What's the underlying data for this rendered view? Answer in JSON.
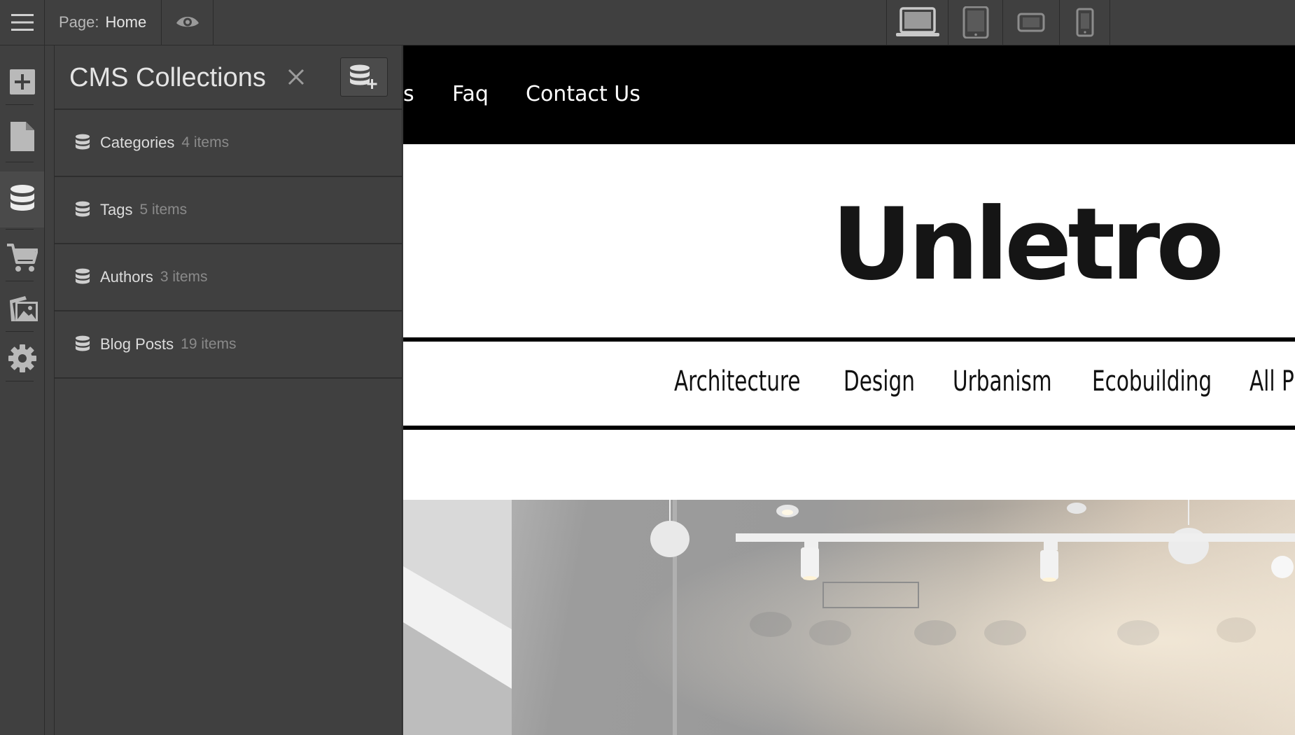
{
  "topbar": {
    "page_label": "Page:",
    "page_value": "Home",
    "icons": [
      "menu-icon",
      "eye-icon"
    ],
    "devices": [
      "desktop-icon",
      "tablet-icon",
      "tablet-landscape-icon",
      "phone-icon"
    ]
  },
  "rail": {
    "items": [
      "add-icon",
      "pages-icon",
      "database-icon",
      "cart-icon",
      "assets-icon",
      "gear-icon"
    ],
    "active": "database-icon"
  },
  "cms": {
    "title": "CMS Collections",
    "collections": [
      {
        "name": "Categories",
        "count": "4 items"
      },
      {
        "name": "Tags",
        "count": "5 items"
      },
      {
        "name": "Authors",
        "count": "3 items"
      },
      {
        "name": "Blog Posts",
        "count": "19 items"
      }
    ]
  },
  "site": {
    "nav": [
      "s",
      "Faq",
      "Contact Us"
    ],
    "logo": "Unletro",
    "categories": [
      "Architecture",
      "Design",
      "Urbanism",
      "Ecobuilding",
      "All P"
    ]
  },
  "colors": {
    "ui_bg": "#404040",
    "ui_border": "#2b2b2b",
    "nav_bg": "#000000",
    "canvas_bg": "#ffffff"
  }
}
